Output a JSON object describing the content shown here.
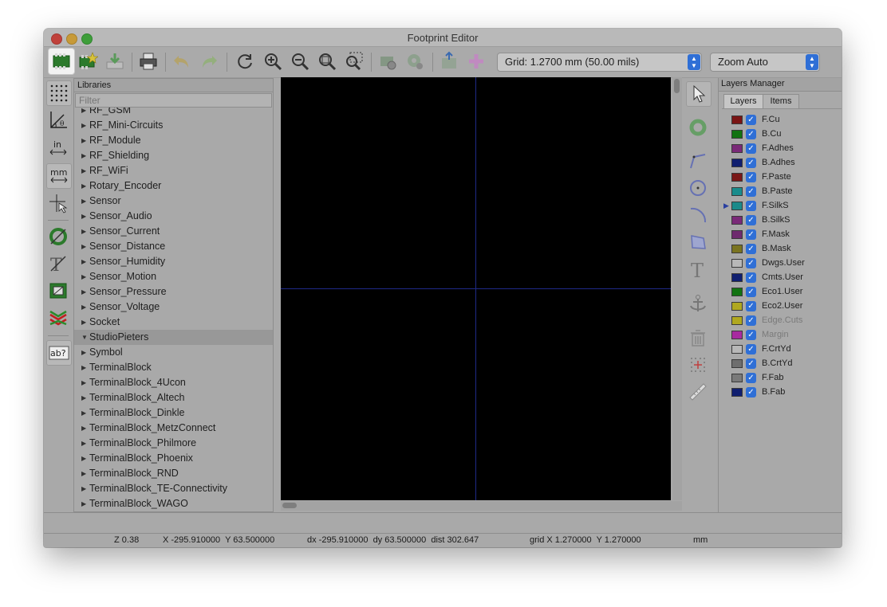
{
  "window": {
    "title": "Footprint Editor"
  },
  "toolbar": {
    "grid_label": "Grid: 1.2700 mm (50.00 mils)",
    "zoom_label": "Zoom Auto",
    "icons": [
      "footprint-editor-icon",
      "new-footprint-icon",
      "save-icon",
      "print-icon",
      "undo-icon",
      "redo-icon",
      "refresh-icon",
      "zoom-in-icon",
      "zoom-out-icon",
      "zoom-fit-icon",
      "zoom-selection-icon",
      "footprint-properties-icon",
      "pad-settings-icon",
      "load-footprint-icon",
      "insert-footprint-icon"
    ]
  },
  "libraries": {
    "header": "Libraries",
    "filter_placeholder": "Filter",
    "items": [
      {
        "name": "RF_GSM",
        "expanded": false,
        "selected": false
      },
      {
        "name": "RF_Mini-Circuits",
        "expanded": false,
        "selected": false
      },
      {
        "name": "RF_Module",
        "expanded": false,
        "selected": false
      },
      {
        "name": "RF_Shielding",
        "expanded": false,
        "selected": false
      },
      {
        "name": "RF_WiFi",
        "expanded": false,
        "selected": false
      },
      {
        "name": "Rotary_Encoder",
        "expanded": false,
        "selected": false
      },
      {
        "name": "Sensor",
        "expanded": false,
        "selected": false
      },
      {
        "name": "Sensor_Audio",
        "expanded": false,
        "selected": false
      },
      {
        "name": "Sensor_Current",
        "expanded": false,
        "selected": false
      },
      {
        "name": "Sensor_Distance",
        "expanded": false,
        "selected": false
      },
      {
        "name": "Sensor_Humidity",
        "expanded": false,
        "selected": false
      },
      {
        "name": "Sensor_Motion",
        "expanded": false,
        "selected": false
      },
      {
        "name": "Sensor_Pressure",
        "expanded": false,
        "selected": false
      },
      {
        "name": "Sensor_Voltage",
        "expanded": false,
        "selected": false
      },
      {
        "name": "Socket",
        "expanded": false,
        "selected": false
      },
      {
        "name": "StudioPieters",
        "expanded": true,
        "selected": true
      },
      {
        "name": "Symbol",
        "expanded": false,
        "selected": false
      },
      {
        "name": "TerminalBlock",
        "expanded": false,
        "selected": false
      },
      {
        "name": "TerminalBlock_4Ucon",
        "expanded": false,
        "selected": false
      },
      {
        "name": "TerminalBlock_Altech",
        "expanded": false,
        "selected": false
      },
      {
        "name": "TerminalBlock_Dinkle",
        "expanded": false,
        "selected": false
      },
      {
        "name": "TerminalBlock_MetzConnect",
        "expanded": false,
        "selected": false
      },
      {
        "name": "TerminalBlock_Philmore",
        "expanded": false,
        "selected": false
      },
      {
        "name": "TerminalBlock_Phoenix",
        "expanded": false,
        "selected": false
      },
      {
        "name": "TerminalBlock_RND",
        "expanded": false,
        "selected": false
      },
      {
        "name": "TerminalBlock_TE-Connectivity",
        "expanded": false,
        "selected": false
      },
      {
        "name": "TerminalBlock_WAGO",
        "expanded": false,
        "selected": false
      }
    ]
  },
  "left_toolbar": {
    "icons": [
      "grid-toggle-icon",
      "polar-coords-icon",
      "inches-units-icon",
      "mm-units-icon",
      "cursor-crosshair-icon",
      "pad-sketch-icon",
      "text-sketch-icon",
      "edge-sketch-icon",
      "high-contrast-icon",
      "text-variable-icon"
    ],
    "inches_label": "in",
    "mm_label": "mm",
    "ab_label": "ab?"
  },
  "right_toolbar": {
    "icons": [
      "select-icon",
      "add-pad-icon",
      "add-line-icon",
      "add-circle-icon",
      "add-arc-icon",
      "add-polygon-icon",
      "add-text-icon",
      "anchor-icon",
      "delete-icon",
      "grid-origin-icon",
      "measure-icon"
    ]
  },
  "layers_manager": {
    "header": "Layers Manager",
    "tabs": [
      "Layers",
      "Items"
    ],
    "active_tab": "Layers",
    "layers": [
      {
        "name": "F.Cu",
        "color": "#7a1414",
        "checked": true,
        "enabled": true,
        "active": false
      },
      {
        "name": "B.Cu",
        "color": "#127312",
        "checked": true,
        "enabled": true,
        "active": false
      },
      {
        "name": "F.Adhes",
        "color": "#7a2a78",
        "checked": true,
        "enabled": true,
        "active": false
      },
      {
        "name": "B.Adhes",
        "color": "#101f70",
        "checked": true,
        "enabled": true,
        "active": false
      },
      {
        "name": "F.Paste",
        "color": "#7a1818",
        "checked": true,
        "enabled": true,
        "active": false
      },
      {
        "name": "B.Paste",
        "color": "#1a8c8c",
        "checked": true,
        "enabled": true,
        "active": false
      },
      {
        "name": "F.SilkS",
        "color": "#1a8a8a",
        "checked": true,
        "enabled": true,
        "active": true
      },
      {
        "name": "B.SilkS",
        "color": "#7a2a78",
        "checked": true,
        "enabled": true,
        "active": false
      },
      {
        "name": "F.Mask",
        "color": "#6e2a6e",
        "checked": true,
        "enabled": true,
        "active": false
      },
      {
        "name": "B.Mask",
        "color": "#7a7420",
        "checked": true,
        "enabled": true,
        "active": false
      },
      {
        "name": "Dwgs.User",
        "color": "#b8b8b8",
        "checked": true,
        "enabled": true,
        "active": false
      },
      {
        "name": "Cmts.User",
        "color": "#101f70",
        "checked": true,
        "enabled": true,
        "active": false
      },
      {
        "name": "Eco1.User",
        "color": "#127312",
        "checked": true,
        "enabled": true,
        "active": false
      },
      {
        "name": "Eco2.User",
        "color": "#b0a820",
        "checked": true,
        "enabled": true,
        "active": false
      },
      {
        "name": "Edge.Cuts",
        "color": "#b0a820",
        "checked": true,
        "enabled": false,
        "active": false
      },
      {
        "name": "Margin",
        "color": "#a82aa0",
        "checked": true,
        "enabled": false,
        "active": false
      },
      {
        "name": "F.CrtYd",
        "color": "#b8b8b8",
        "checked": true,
        "enabled": true,
        "active": false
      },
      {
        "name": "B.CrtYd",
        "color": "#6e6e6e",
        "checked": true,
        "enabled": true,
        "active": false
      },
      {
        "name": "F.Fab",
        "color": "#7a7a7a",
        "checked": true,
        "enabled": true,
        "active": false
      },
      {
        "name": "B.Fab",
        "color": "#101f70",
        "checked": true,
        "enabled": true,
        "active": false
      }
    ]
  },
  "statusbar": {
    "zoom": "Z 0.38",
    "xy": "X -295.910000  Y 63.500000",
    "dxy": "dx -295.910000  dy 63.500000  dist 302.647",
    "grid": "grid X 1.270000  Y 1.270000",
    "units": "mm"
  },
  "colors": {
    "canvas_bg": "#000000",
    "crosshair": "#1f2a88",
    "accent_blue": "#2f6fd6"
  }
}
